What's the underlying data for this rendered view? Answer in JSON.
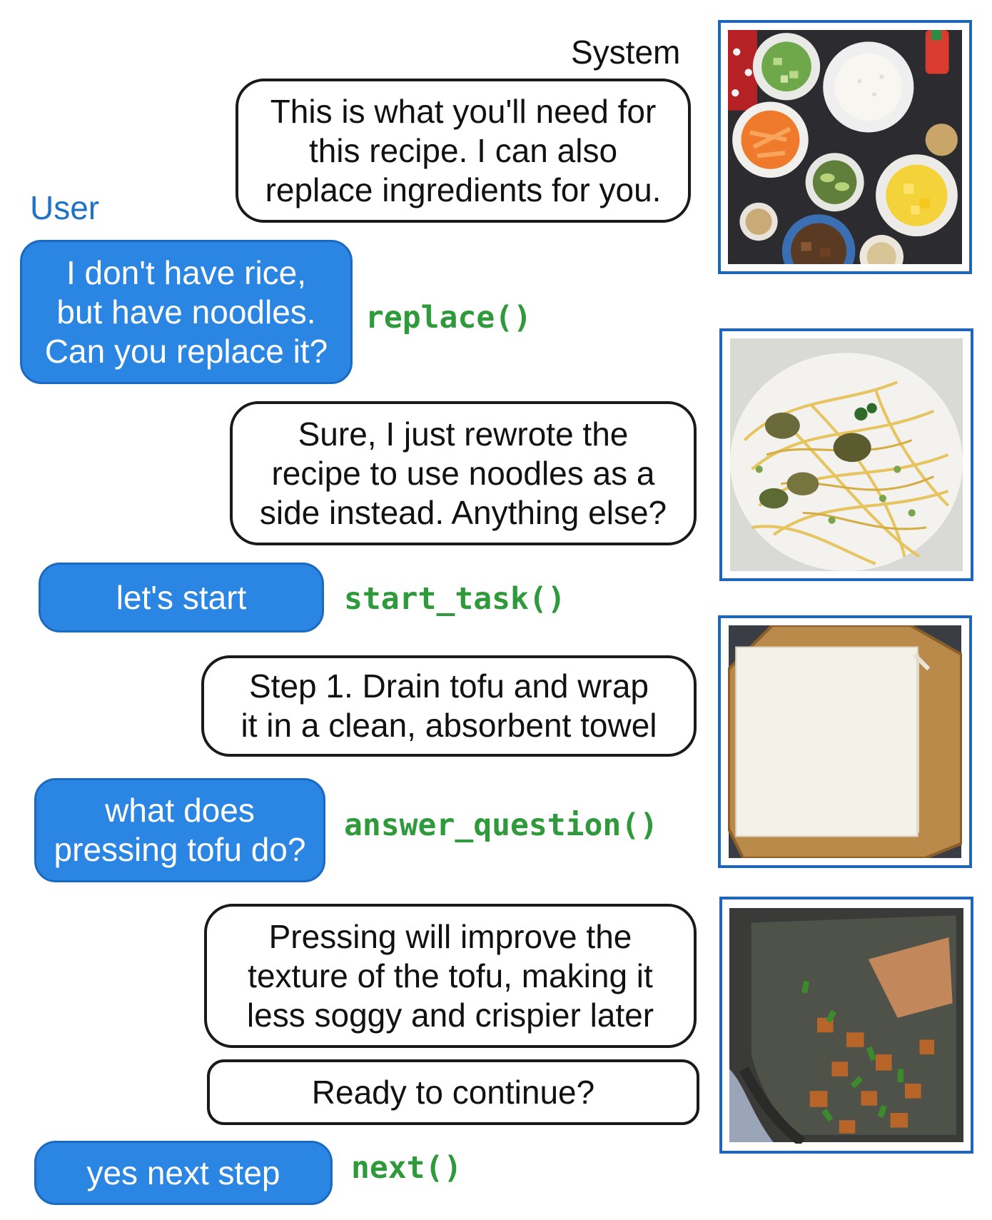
{
  "speakers": {
    "system": "System",
    "user": "User"
  },
  "turns": [
    {
      "role": "system",
      "text": "This is what you'll need for\nthis recipe. I can also\nreplace ingredients for you."
    },
    {
      "role": "user",
      "text": "I don't have rice,\nbut have noodles.\nCan you replace it?",
      "function": "replace()"
    },
    {
      "role": "system",
      "text": "Sure, I just rewrote the\nrecipe to use noodles as a\nside instead. Anything else?"
    },
    {
      "role": "user",
      "text": "let's start",
      "function": "start_task()"
    },
    {
      "role": "system",
      "text": "Step 1. Drain tofu and wrap\nit in a clean, absorbent towel"
    },
    {
      "role": "user",
      "text": "what does\npressing tofu do?",
      "function": "answer_question()"
    },
    {
      "role": "system",
      "text": "Pressing will improve the\ntexture of the tofu, making it\nless soggy and crispier later"
    },
    {
      "role": "system",
      "text": "Ready to continue?"
    },
    {
      "role": "user",
      "text": "yes next step",
      "function": "next()"
    }
  ],
  "colors": {
    "user_bubble": "#2a86e2",
    "function_text": "#2f9a3b",
    "speaker_user": "#1e73c8",
    "image_border": "#1f66b9"
  },
  "images": [
    {
      "name": "ingredients-photo",
      "subject": "overhead view of bowls of rice, carrots, cucumber, avocado, mango and tofu"
    },
    {
      "name": "noodles-photo",
      "subject": "plate of spaghetti noodles with artichoke and peas"
    },
    {
      "name": "tofu-towel-photo",
      "subject": "tofu wrapped in a paper towel on a wooden board"
    },
    {
      "name": "tofu-pan-photo",
      "subject": "crispy tofu with scallions in a wok"
    }
  ]
}
